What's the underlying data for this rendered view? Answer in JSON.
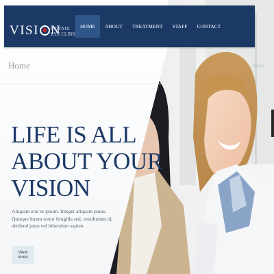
{
  "brand": {
    "logo_pre": "VISI",
    "logo_post": "N",
    "tagline": "Private Eye Clinic"
  },
  "nav": {
    "items": [
      {
        "label": "Home"
      },
      {
        "label": "About"
      },
      {
        "label": "Treatment"
      },
      {
        "label": "Staff"
      },
      {
        "label": "Contact"
      }
    ]
  },
  "breadcrumb": {
    "current": "Home",
    "right_text": "Home"
  },
  "hero": {
    "headline_line1": "Life is all",
    "headline_line2": "about your",
    "headline_line3": "vision",
    "body": "Aliquam erat ut ipsum. Integer aliquam purus. Quisque lorem tortor fringilla sed, vestibulum id, eleifend justo vel bibendum sapien.",
    "cta_label": "View more"
  },
  "colors": {
    "brand_navy": "#1c3966",
    "nav_active": "#2e5688",
    "logo_accent": "#c0262d",
    "cta_bg": "#e2ebef"
  }
}
